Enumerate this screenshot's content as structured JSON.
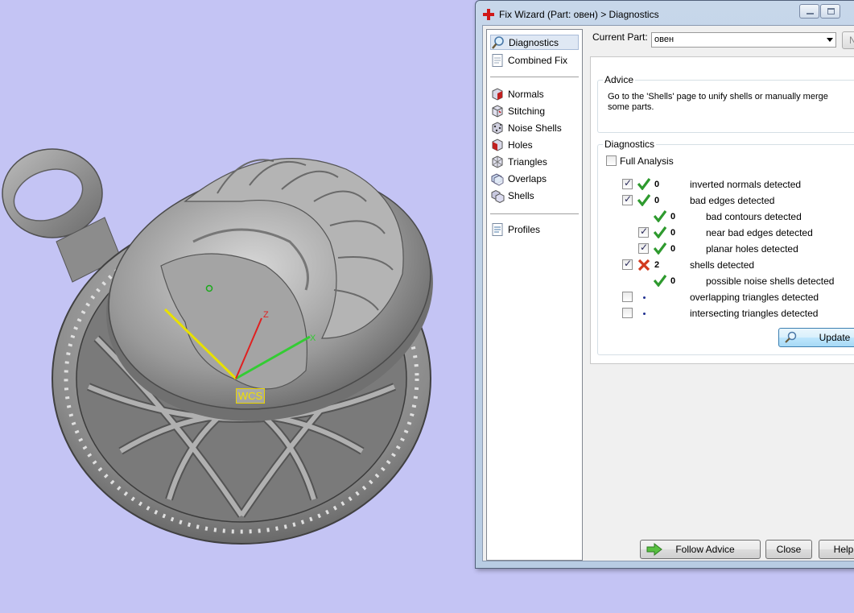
{
  "viewport": {
    "background": "#c4c4f4",
    "wcs_label": "WCS",
    "axis_x": "X",
    "axis_z": "Z",
    "axis_colors": {
      "x": "#33cc33",
      "y": "#e8e000",
      "z": "#e02020"
    }
  },
  "dialog": {
    "title": "Fix Wizard (Part: овен) > Diagnostics",
    "title_icon": "red-cross-icon",
    "current_part_label": "Current Part:",
    "current_part_value": "овен",
    "next_button_label": "N",
    "nav": {
      "group1": [
        {
          "label": "Diagnostics",
          "icon": "magnifier-icon",
          "selected": true
        },
        {
          "label": "Combined Fix",
          "icon": "document-icon",
          "selected": false
        }
      ],
      "group2": [
        {
          "label": "Normals",
          "icon": "normals-cube-icon"
        },
        {
          "label": "Stitching",
          "icon": "stitching-cube-icon"
        },
        {
          "label": "Noise Shells",
          "icon": "noise-shells-icon"
        },
        {
          "label": "Holes",
          "icon": "holes-cube-icon"
        },
        {
          "label": "Triangles",
          "icon": "triangles-cube-icon"
        },
        {
          "label": "Overlaps",
          "icon": "overlaps-icon"
        },
        {
          "label": "Shells",
          "icon": "shells-icon"
        }
      ],
      "group3": [
        {
          "label": "Profiles",
          "icon": "profiles-document-icon"
        }
      ]
    },
    "advice": {
      "title": "Advice",
      "text": "Go to the 'Shells' page to unify shells or manually merge some parts."
    },
    "diagnostics": {
      "title": "Diagnostics",
      "full_analysis_label": "Full Analysis",
      "full_analysis_checked": false,
      "rows": [
        {
          "checkbox": true,
          "checked": true,
          "status": "ok",
          "count": "0",
          "label": "inverted normals detected",
          "indent": 0
        },
        {
          "checkbox": true,
          "checked": true,
          "status": "ok",
          "count": "0",
          "label": "bad edges detected",
          "indent": 0
        },
        {
          "checkbox": false,
          "checked": false,
          "status": "ok",
          "count": "0",
          "label": "bad contours detected",
          "indent": 1
        },
        {
          "checkbox": true,
          "checked": true,
          "status": "ok",
          "count": "0",
          "label": "near bad edges detected",
          "indent": 1
        },
        {
          "checkbox": true,
          "checked": true,
          "status": "ok",
          "count": "0",
          "label": "planar holes detected",
          "indent": 1
        },
        {
          "checkbox": true,
          "checked": true,
          "status": "error",
          "count": "2",
          "label": "shells detected",
          "indent": 0
        },
        {
          "checkbox": false,
          "checked": false,
          "status": "ok",
          "count": "0",
          "label": "possible noise shells detected",
          "indent": 1
        },
        {
          "checkbox": true,
          "checked": false,
          "status": "none",
          "count": "",
          "label": "overlapping triangles detected",
          "indent": 0
        },
        {
          "checkbox": true,
          "checked": false,
          "status": "none",
          "count": "",
          "label": "intersecting triangles detected",
          "indent": 0
        }
      ],
      "update_label": "Update"
    },
    "buttons": {
      "follow_advice": "Follow Advice",
      "close": "Close",
      "help": "Help"
    },
    "colors": {
      "ok": "#2e9a2e",
      "error": "#d23a1e",
      "accent": "#3c7fb1"
    }
  }
}
